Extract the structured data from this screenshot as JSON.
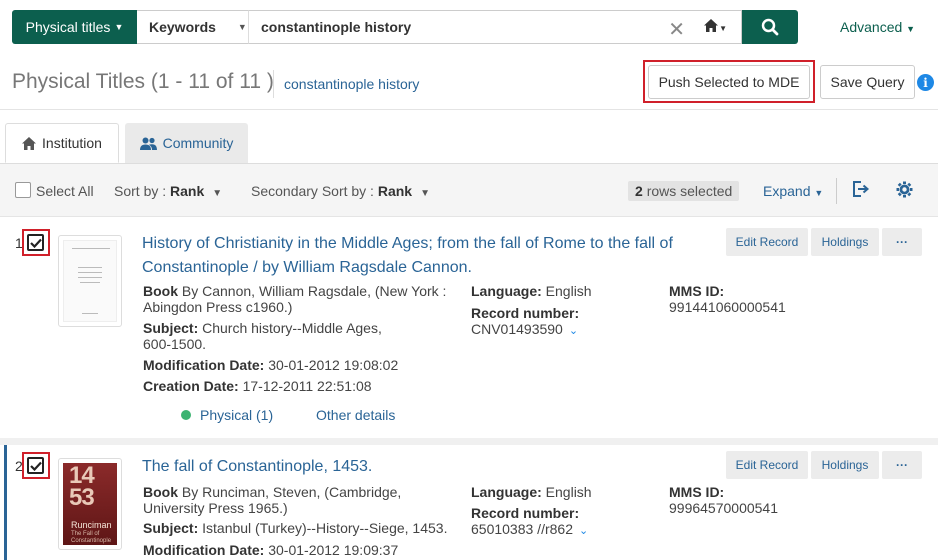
{
  "search": {
    "scope": "Physical titles",
    "field": "Keywords",
    "query": "constantinople history",
    "advanced": "Advanced"
  },
  "header": {
    "title": "Physical Titles (1 - 11 of 11 )",
    "query_link": "constantinople history",
    "push_button": "Push Selected to MDE",
    "save_query": "Save Query"
  },
  "tabs": [
    {
      "label": "Institution"
    },
    {
      "label": "Community"
    }
  ],
  "toolbar": {
    "select_all": "Select All",
    "sort_label": "Sort by :",
    "sort_value": "Rank",
    "secondary_label": "Secondary Sort by :",
    "secondary_value": "Rank",
    "rows_count": "2",
    "rows_text": "rows selected",
    "expand": "Expand"
  },
  "results": [
    {
      "num": "1",
      "title_line1": "History of Christianity in the Middle Ages; from the fall of Rome to the fall of",
      "title_line2": "Constantinople / by William Ragsdale Cannon.",
      "book_label": "Book",
      "book_line1": "By Cannon, William Ragsdale, (New York :",
      "book_line2": "Abingdon Press c1960.)",
      "subject_label": "Subject:",
      "subject_line1": "Church history--Middle Ages,",
      "subject_line2": "600-1500.",
      "mod_label": "Modification Date:",
      "mod_value": "30-01-2012 19:08:02",
      "created_label": "Creation Date:",
      "created_value": "17-12-2011 22:51:08",
      "language_label": "Language:",
      "language_value": "English",
      "record_label": "Record number:",
      "record_value": "CNV01493590",
      "mms_label": "MMS ID:",
      "mms_value": "991441060000541",
      "physical": "Physical (1)",
      "other": "Other details",
      "edit": "Edit Record",
      "holdings": "Holdings",
      "more": "···"
    },
    {
      "num": "2",
      "title_line1": "The fall of Constantinople, 1453.",
      "book_label": "Book",
      "book_line1": "By Runciman, Steven, (Cambridge,",
      "book_line2": "University Press 1965.)",
      "subject_label": "Subject:",
      "subject_line1": "Istanbul (Turkey)--History--Siege, 1453.",
      "mod_label": "Modification Date:",
      "mod_value": "30-01-2012 19:09:37",
      "language_label": "Language:",
      "language_value": "English",
      "record_label": "Record number:",
      "record_value": "65010383 //r862",
      "mms_label": "MMS ID:",
      "mms_value": "99964570000541",
      "edit": "Edit Record",
      "holdings": "Holdings",
      "more": "···",
      "cover_big": "14 53",
      "cover_author": "Runciman",
      "cover_subtitle": "The Fall of Constantinople"
    }
  ],
  "colors": {
    "primary": "#0c5f4e",
    "link": "#2a6496",
    "highlight": "#d0202a",
    "available": "#3cb371"
  },
  "icons": [
    "search-icon",
    "home-icon",
    "clear-icon",
    "institution-icon",
    "community-icon",
    "export-icon",
    "gear-icon",
    "info-icon",
    "checkmark-icon",
    "double-chevron-icon"
  ]
}
